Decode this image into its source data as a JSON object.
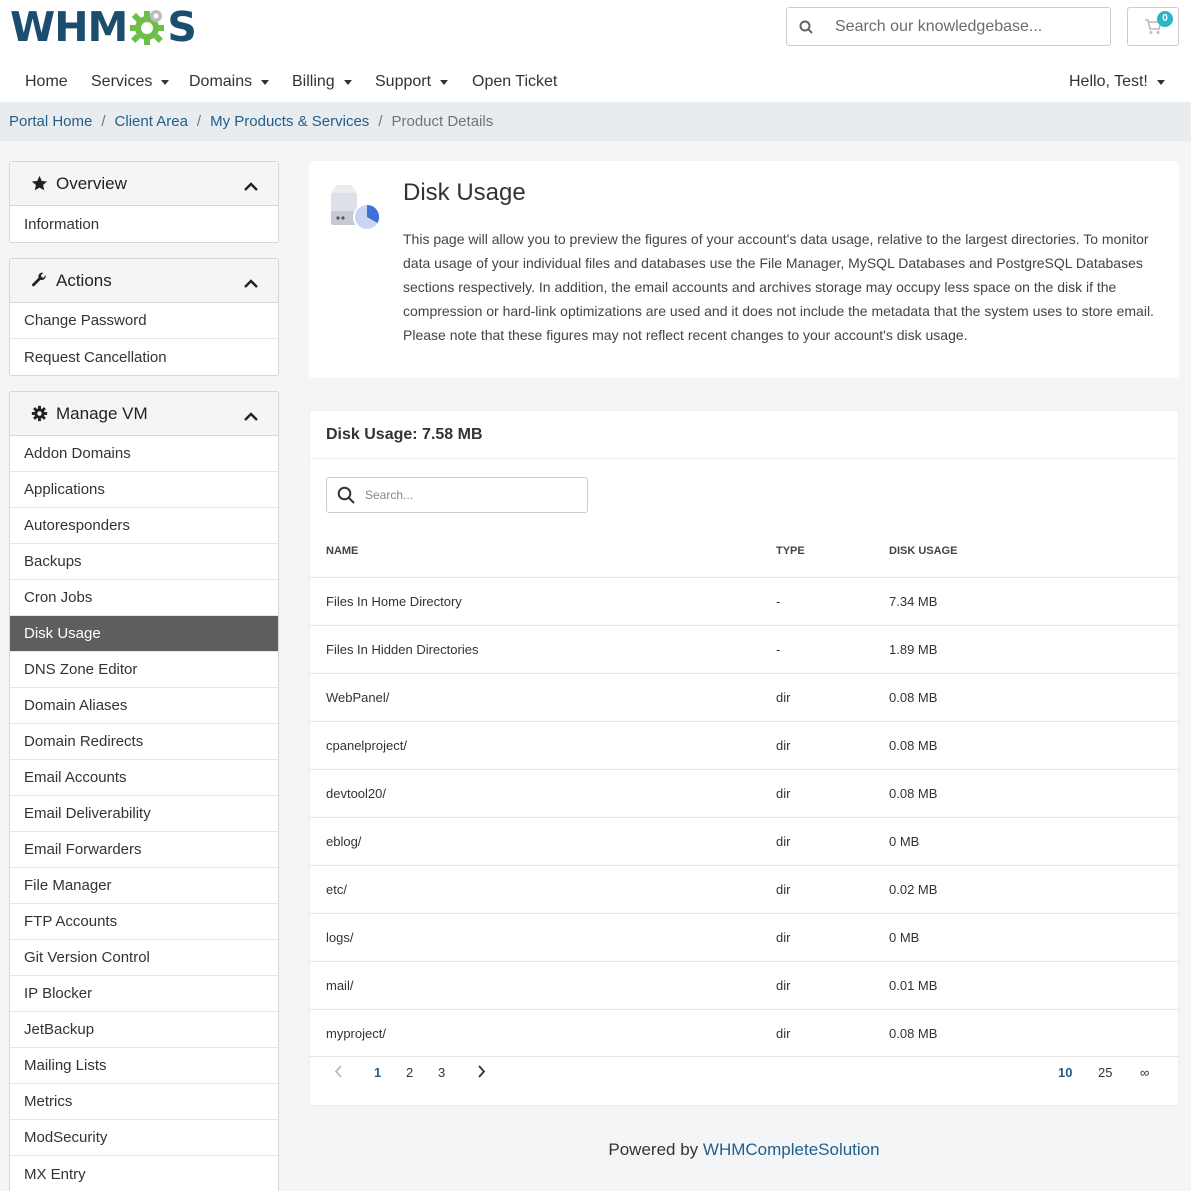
{
  "logo": {
    "text_left": "WHM",
    "text_right": "S"
  },
  "header": {
    "search_placeholder": "Search our knowledgebase...",
    "cart_count": "0",
    "nav": [
      {
        "label": "Home"
      },
      {
        "label": "Services"
      },
      {
        "label": "Domains"
      },
      {
        "label": "Billing"
      },
      {
        "label": "Support"
      },
      {
        "label": "Open Ticket"
      }
    ],
    "user_menu": "Hello, Test!"
  },
  "breadcrumb": {
    "items": [
      "Portal Home",
      "Client Area",
      "My Products & Services"
    ],
    "current": "Product Details"
  },
  "sidebar": {
    "overview": {
      "title": "Overview",
      "items": [
        "Information"
      ]
    },
    "actions": {
      "title": "Actions",
      "items": [
        "Change Password",
        "Request Cancellation"
      ]
    },
    "manage": {
      "title": "Manage VM",
      "items": [
        "Addon Domains",
        "Applications",
        "Autoresponders",
        "Backups",
        "Cron Jobs",
        "Disk Usage",
        "DNS Zone Editor",
        "Domain Aliases",
        "Domain Redirects",
        "Email Accounts",
        "Email Deliverability",
        "Email Forwarders",
        "File Manager",
        "FTP Accounts",
        "Git Version Control",
        "IP Blocker",
        "JetBackup",
        "Mailing Lists",
        "Metrics",
        "ModSecurity",
        "MX Entry"
      ],
      "active": "Disk Usage"
    }
  },
  "intro": {
    "title": "Disk Usage",
    "text": "This page will allow you to preview the figures of your account's data usage, relative to the largest directories. To monitor data usage of your individual files and databases use the File Manager, MySQL Databases and PostgreSQL Databases sections respectively. In addition, the email accounts and archives storage may occupy less space on the disk if the compression or hard-link optimizations are used and it does not include the metadata that the system uses to store email. Please note that these figures may not reflect recent changes to your account's disk usage."
  },
  "table": {
    "title": "Disk Usage: 7.58 MB",
    "search_placeholder": "Search...",
    "columns": [
      "NAME",
      "TYPE",
      "DISK USAGE"
    ],
    "rows": [
      [
        "Files In Home Directory",
        "-",
        "7.34 MB"
      ],
      [
        "Files In Hidden Directories",
        "-",
        "1.89 MB"
      ],
      [
        "WebPanel/",
        "dir",
        "0.08 MB"
      ],
      [
        "cpanelproject/",
        "dir",
        "0.08 MB"
      ],
      [
        "devtool20/",
        "dir",
        "0.08 MB"
      ],
      [
        "eblog/",
        "dir",
        "0 MB"
      ],
      [
        "etc/",
        "dir",
        "0.02 MB"
      ],
      [
        "logs/",
        "dir",
        "0 MB"
      ],
      [
        "mail/",
        "dir",
        "0.01 MB"
      ],
      [
        "myproject/",
        "dir",
        "0.08 MB"
      ]
    ],
    "pages": [
      "1",
      "2",
      "3"
    ],
    "current_page": "1",
    "page_sizes": [
      "10",
      "25",
      "∞"
    ],
    "current_size": "10"
  },
  "footer": {
    "prefix": "Powered by",
    "link": "WHMCompleteSolution"
  },
  "colors": {
    "brand": "#1a4d6e",
    "link": "#1f5f8b",
    "gear": "#6cc04a",
    "active_item": "#5e5e5e"
  },
  "icons": {
    "search": "search-icon",
    "cart": "cart-icon",
    "overview": "star-icon",
    "actions": "wrench-icon",
    "manage": "gear-icon",
    "collapse": "chevron-up-icon",
    "disk": "disk-usage-icon"
  }
}
